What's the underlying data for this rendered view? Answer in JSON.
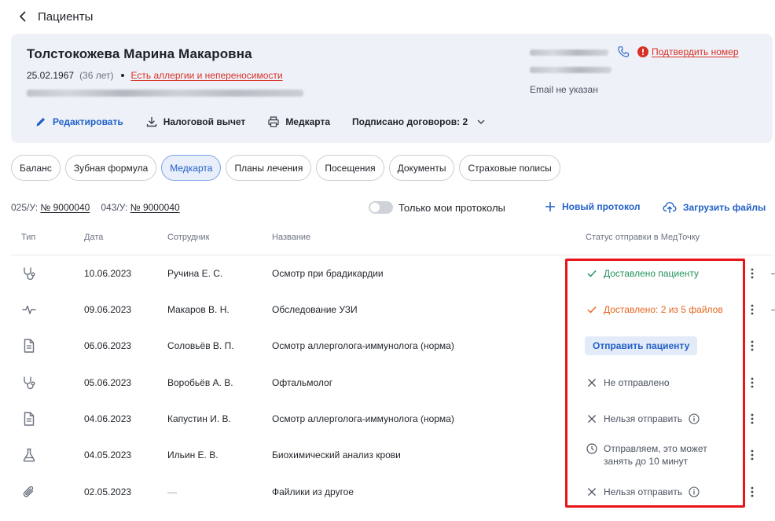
{
  "header": {
    "title": "Пациенты"
  },
  "patient": {
    "name": "Толстокожева Марина Макаровна",
    "birthdate": "25.02.1967",
    "age": "(36 лет)",
    "allergy_link": "Есть аллергии и непереносимости",
    "confirm_phone": "Подтвердить номер",
    "email": "Email не указан"
  },
  "actions": {
    "edit": "Редактировать",
    "tax": "Налоговой вычет",
    "medcard": "Медкарта",
    "contracts": "Подписано договоров: 2"
  },
  "tabs": [
    {
      "label": "Баланс"
    },
    {
      "label": "Зубная формула"
    },
    {
      "label": "Медкарта"
    },
    {
      "label": "Планы лечения"
    },
    {
      "label": "Посещения"
    },
    {
      "label": "Документы"
    },
    {
      "label": "Страховые полисы"
    }
  ],
  "forms": {
    "f025_label": "025/У:",
    "f025_value": "№ 9000040",
    "f043_label": "043/У:",
    "f043_value": "№ 9000040"
  },
  "toolbar": {
    "only_mine": "Только мои протоколы",
    "new_protocol": "Новый протокол",
    "upload": "Загрузить файлы"
  },
  "table": {
    "columns": [
      "Тип",
      "Дата",
      "Сотрудник",
      "Название",
      "Статус отправки в МедТочку"
    ],
    "rows": [
      {
        "icon": "stethoscope-icon",
        "date": "10.06.2023",
        "employee": "Ручина Е. С.",
        "title": "Осмотр при брадикардии",
        "status": "Доставлено пациенту",
        "status_kind": "ok"
      },
      {
        "icon": "pulse-icon",
        "date": "09.06.2023",
        "employee": "Макаров В. Н.",
        "title": "Обследование УЗИ",
        "status": "Доставлено: 2 из 5 файлов",
        "status_kind": "partial"
      },
      {
        "icon": "document-icon",
        "date": "06.06.2023",
        "employee": "Соловьёв В. П.",
        "title": "Осмотр аллерголога-иммунолога (норма)",
        "status": "Отправить пациенту",
        "status_kind": "button"
      },
      {
        "icon": "stethoscope-icon",
        "date": "05.06.2023",
        "employee": "Воробьёв А. В.",
        "title": "Офтальмолог",
        "status": "Не отправлено",
        "status_kind": "none"
      },
      {
        "icon": "document-icon",
        "date": "04.06.2023",
        "employee": "Капустин И. В.",
        "title": "Осмотр аллерголога-иммунолога (норма)",
        "status": "Нельзя отправить",
        "status_kind": "blocked"
      },
      {
        "icon": "flask-icon",
        "date": "04.05.2023",
        "employee": "Ильин Е. В.",
        "title": "Биохимический анализ крови",
        "status_line1": "Отправляем, это может",
        "status_line2": "занять до 10 минут",
        "status_kind": "pending"
      },
      {
        "icon": "paperclip-icon",
        "date": "02.05.2023",
        "employee": "—",
        "title": "Файлики из другое",
        "status": "Нельзя отправить",
        "status_kind": "blocked"
      }
    ]
  },
  "colors": {
    "accent": "#2260c7",
    "danger": "#d93025",
    "success": "#23925a",
    "warning": "#e5661f",
    "highlight": "#e8151b"
  }
}
